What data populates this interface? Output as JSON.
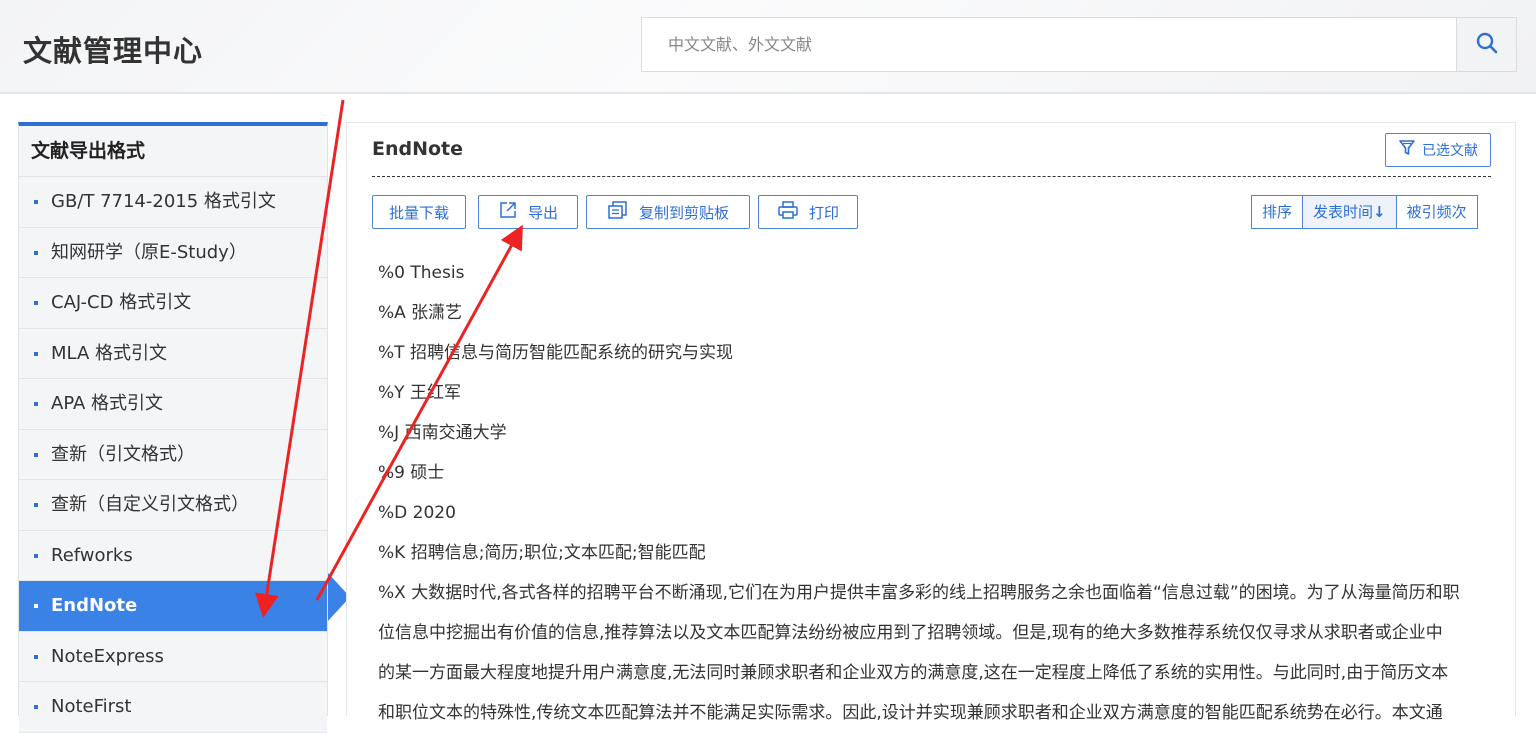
{
  "header": {
    "app_title": "文献管理中心",
    "search_placeholder": "中文文献、外文文献"
  },
  "sidebar": {
    "title": "文献导出格式",
    "items": [
      {
        "label": "GB/T 7714-2015 格式引文"
      },
      {
        "label": "知网研学（原E-Study）"
      },
      {
        "label": "CAJ-CD 格式引文"
      },
      {
        "label": "MLA 格式引文"
      },
      {
        "label": "APA 格式引文"
      },
      {
        "label": "查新（引文格式）"
      },
      {
        "label": "查新（自定义引文格式）"
      },
      {
        "label": "Refworks"
      },
      {
        "label": "EndNote",
        "active": true
      },
      {
        "label": "NoteExpress"
      },
      {
        "label": "NoteFirst"
      }
    ]
  },
  "main": {
    "title": "EndNote",
    "selected_button": "已选文献",
    "toolbar": {
      "batch_download": "批量下载",
      "export": "导出",
      "copy_to_clipboard": "复制到剪贴板",
      "print": "打印"
    },
    "sort": {
      "label": "排序",
      "by_date": "发表时间",
      "by_citations": "被引频次"
    },
    "record": {
      "type": "%0 Thesis",
      "author": "%A 张潇艺",
      "title": "%T 招聘信息与简历智能匹配系统的研究与实现",
      "advisor": "%Y 王红军",
      "school": "%J 西南交通大学",
      "degree": "%9 硕士",
      "year": "%D 2020",
      "keywords": "%K 招聘信息;简历;职位;文本匹配;智能匹配",
      "abstract_lines": [
        "%X 大数据时代,各式各样的招聘平台不断涌现,它们在为用户提供丰富多彩的线上招聘服务之余也面临着“信息过载”的困境。为了从海量简历和职",
        "位信息中挖掘出有价值的信息,推荐算法以及文本匹配算法纷纷被应用到了招聘领域。但是,现有的绝大多数推荐系统仅仅寻求从求职者或企业中",
        "的某一方面最大程度地提升用户满意度,无法同时兼顾求职者和企业双方的满意度,这在一定程度上降低了系统的实用性。与此同时,由于简历文本",
        "和职位文本的特殊性,传统文本匹配算法并不能满足实际需求。因此,设计并实现兼顾求职者和企业双方满意度的智能匹配系统势在必行。本文通"
      ]
    }
  },
  "colors": {
    "accent": "#2d6fd6",
    "active_item_bg": "#3b82e6",
    "annotation_arrow": "#ee2222"
  }
}
